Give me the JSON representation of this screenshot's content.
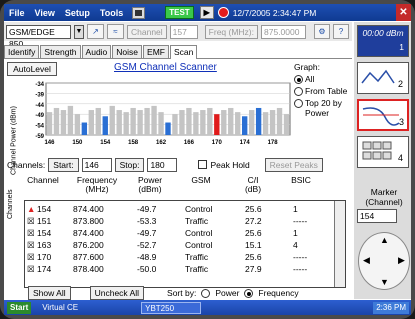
{
  "menubar": {
    "items": [
      "File",
      "View",
      "Setup",
      "Tools"
    ],
    "test_label": "TEST",
    "datetime": "12/7/2005 2:34:47 PM"
  },
  "toolbar": {
    "technology": "GSM/EDGE 850",
    "channel_button": "Channel",
    "channel_value": "157",
    "freq_button": "Freq (MHz):",
    "freq_value": "875.0000"
  },
  "tabs": [
    {
      "label": "Identify"
    },
    {
      "label": "Strength"
    },
    {
      "label": "Audio"
    },
    {
      "label": "Noise"
    },
    {
      "label": "EMF"
    },
    {
      "label": "Scan"
    }
  ],
  "scan": {
    "autolevel": "AutoLevel",
    "title": "GSM Channel Scanner",
    "y_axis_label": "Channel Power (dBm)",
    "graph_label": "Graph:",
    "graph_options": [
      "All",
      "From Table",
      "Top 20 by Power"
    ],
    "channels_label": "Channels:",
    "start_label": "Start:",
    "start_value": "146",
    "stop_label": "Stop:",
    "stop_value": "180",
    "peak_hold": "Peak Hold",
    "reset_peaks": "Reset Peaks"
  },
  "chart_data": {
    "type": "bar",
    "ylabel": "Channel Power (dBm)",
    "x": [
      146,
      147,
      148,
      149,
      150,
      151,
      152,
      153,
      154,
      155,
      156,
      157,
      158,
      159,
      160,
      161,
      162,
      163,
      164,
      165,
      166,
      167,
      168,
      169,
      170,
      171,
      172,
      173,
      174,
      175,
      176,
      177,
      178,
      179,
      180
    ],
    "values": [
      -48,
      -46,
      -47,
      -45,
      -49,
      -53,
      -47,
      -46,
      -50,
      -45,
      -47,
      -48,
      -46,
      -47,
      -46,
      -45,
      -48,
      -53,
      -49,
      -47,
      -46,
      -48,
      -47,
      -46,
      -49,
      -47,
      -46,
      -48,
      -50,
      -47,
      -46,
      -48,
      -47,
      -46,
      -49
    ],
    "yticks": [
      "-34",
      "-39",
      "-44",
      "-49",
      "-54",
      "-59"
    ],
    "xticks": [
      "146",
      "150",
      "154",
      "158",
      "162",
      "166",
      "170",
      "174",
      "178"
    ],
    "highlight": [
      151,
      154,
      163,
      170,
      174,
      176
    ],
    "highlight_colors": [
      "#2a6fd4",
      "#2a6fd4",
      "#2a6fd4",
      "#e01b1b",
      "#2a6fd4",
      "#2a6fd4"
    ],
    "ylim": [
      -59,
      -34
    ]
  },
  "table": {
    "headers": [
      "Channel",
      "Frequency (MHz)",
      "Power (dBm)",
      "GSM",
      "C/I (dB)",
      "BSIC"
    ],
    "rows": [
      {
        "channel": "154",
        "freq": "874.400",
        "power": "-49.7",
        "gsm": "Control",
        "ci": "25.6",
        "bsic": "1"
      },
      {
        "channel": "151",
        "freq": "873.800",
        "power": "-53.3",
        "gsm": "Traffic",
        "ci": "27.2",
        "bsic": "-----"
      },
      {
        "channel": "154",
        "freq": "874.400",
        "power": "-49.7",
        "gsm": "Control",
        "ci": "25.6",
        "bsic": "1"
      },
      {
        "channel": "163",
        "freq": "876.200",
        "power": "-52.7",
        "gsm": "Control",
        "ci": "15.1",
        "bsic": "4"
      },
      {
        "channel": "170",
        "freq": "877.600",
        "power": "-48.9",
        "gsm": "Traffic",
        "ci": "25.6",
        "bsic": "-----"
      },
      {
        "channel": "174",
        "freq": "878.400",
        "power": "-50.0",
        "gsm": "Traffic",
        "ci": "27.9",
        "bsic": "-----"
      }
    ],
    "side_label": "Channels"
  },
  "bottom": {
    "show_all": "Show All",
    "uncheck_all": "Uncheck All",
    "sort_by": "Sort by:",
    "sort_power": "Power",
    "sort_frequency": "Frequency"
  },
  "right": {
    "tile1": "00:00 dBm",
    "tile1_num": "1",
    "tile2_num": "2",
    "tile3_num": "3",
    "tile4_num": "4",
    "marker_label": "Marker (Channel)",
    "marker_value": "154"
  },
  "taskbar": {
    "start": "Start",
    "virtual": "Virtual CE",
    "app": "YBT250",
    "time": "2:36 PM"
  }
}
